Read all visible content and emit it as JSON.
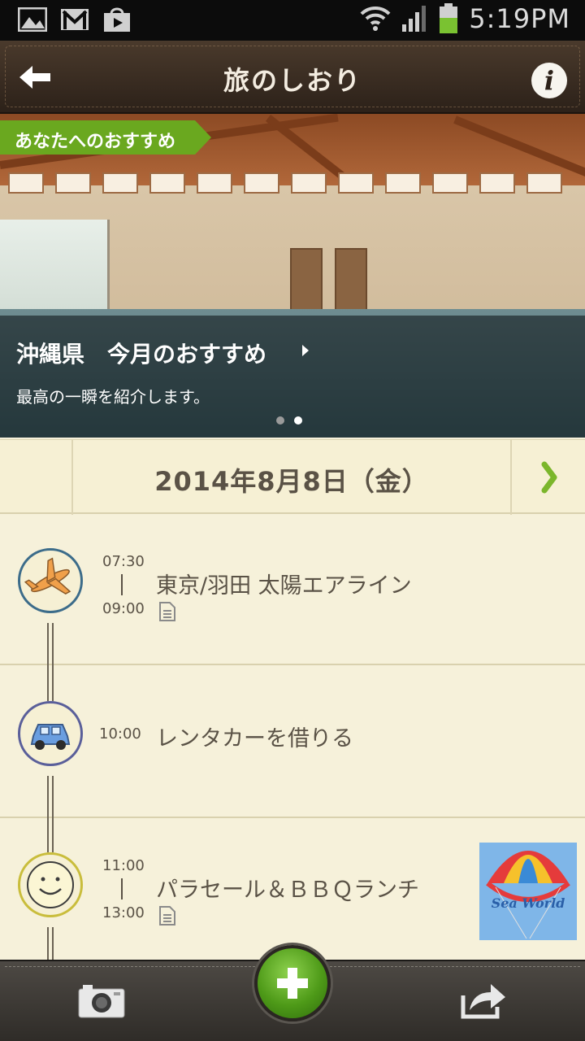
{
  "status_bar": {
    "time": "5:19PM",
    "left_icons": [
      "gallery-icon",
      "gmail-icon",
      "store-icon"
    ],
    "right_icons": [
      "wifi-icon",
      "signal-icon",
      "battery-icon"
    ],
    "battery_color": "#7ac231"
  },
  "header": {
    "title": "旅のしおり",
    "back_icon": "back-arrow-icon",
    "info_icon": "info-icon",
    "info_glyph": "i"
  },
  "hero": {
    "tag": "あなたへのおすすめ",
    "tag_color": "#6aa81f",
    "title": "沖縄県　今月のおすすめ",
    "subtitle": "最高の一瞬を紹介します。",
    "page_count": 2,
    "active_page": 2
  },
  "date_bar": {
    "date": "2014年8月8日（金）",
    "next_icon": "chevron-right-icon",
    "accent": "#7bb62b"
  },
  "events": [
    {
      "icon": "airplane-icon",
      "icon_border": "#3c6c8a",
      "start": "07:30",
      "end": "09:00",
      "title": "東京/羽田 太陽エアライン",
      "has_memo": true
    },
    {
      "icon": "car-icon",
      "icon_border": "#5a5f9a",
      "start": "10:00",
      "title": "レンタカーを借りる",
      "has_memo": false
    },
    {
      "icon": "smiley-icon",
      "icon_border": "#c9bd3c",
      "start": "11:00",
      "end": "13:00",
      "title": "パラセール＆ＢＢＱランチ",
      "has_memo": true,
      "thumbnail_text": "Sea World"
    }
  ],
  "bottom_bar": {
    "camera_icon": "camera-icon",
    "add_icon": "plus-icon",
    "share_icon": "share-icon",
    "add_glyph": "+"
  }
}
